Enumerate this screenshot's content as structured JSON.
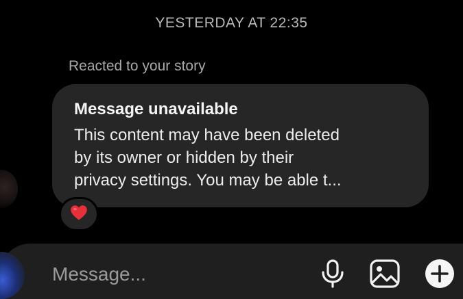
{
  "thread": {
    "timestamp": "YESTERDAY AT 22:35",
    "reaction_note": "Reacted to your story"
  },
  "message": {
    "title": "Message unavailable",
    "lines": [
      "This content may have been deleted",
      "by its owner or hidden by their",
      "privacy settings. You may be able t..."
    ],
    "reaction_emoji": "heart-emoji"
  },
  "composer": {
    "placeholder": "Message...",
    "icons": [
      "microphone-icon",
      "gallery-icon",
      "add-icon"
    ]
  },
  "colors": {
    "background": "#000000",
    "bubble": "#262626",
    "composer": "#1f1f1f",
    "heart": "#e8303a"
  }
}
